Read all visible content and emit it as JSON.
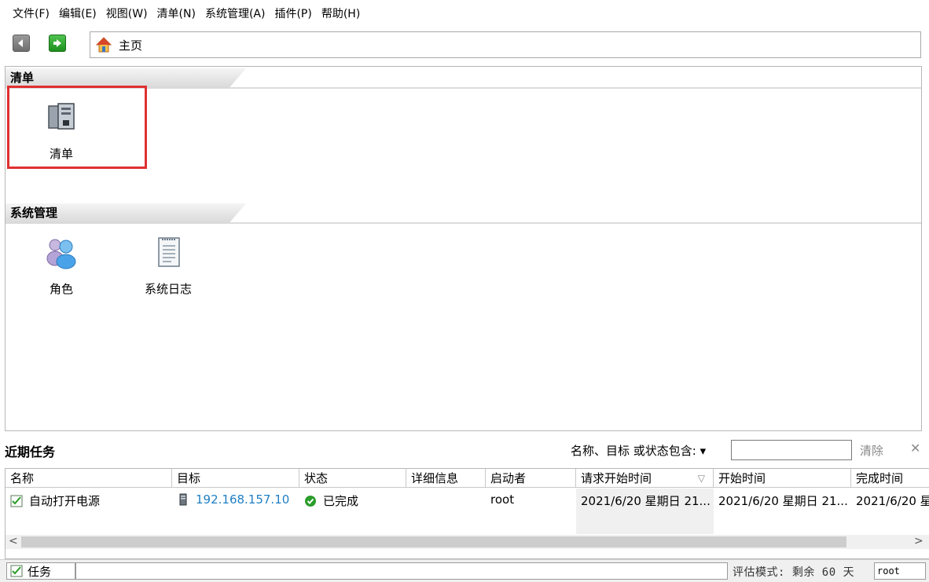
{
  "menu": [
    "文件(F)",
    "编辑(E)",
    "视图(W)",
    "清单(N)",
    "系统管理(A)",
    "插件(P)",
    "帮助(H)"
  ],
  "address": {
    "text": "主页"
  },
  "sections": [
    {
      "title": "清单",
      "tiles": [
        {
          "label": "清单",
          "icon": "inventory-icon"
        }
      ]
    },
    {
      "title": "系统管理",
      "tiles": [
        {
          "label": "角色",
          "icon": "roles-icon"
        },
        {
          "label": "系统日志",
          "icon": "system-log-icon"
        }
      ]
    }
  ],
  "recent_tasks": {
    "title": "近期任务",
    "filter_label": "名称、目标 或状态包含: ▾",
    "filter_value": "",
    "clear_label": "清除",
    "columns": [
      "名称",
      "目标",
      "状态",
      "详细信息",
      "启动者",
      "请求开始时间",
      "开始时间",
      "完成时间"
    ],
    "rows": [
      {
        "name": "自动打开电源",
        "target": "192.168.157.10",
        "status": "已完成",
        "details": "",
        "initiator": "root",
        "requested": "2021/6/20 星期日 21...",
        "start": "2021/6/20 星期日 21...",
        "completed": "2021/6/20 星"
      }
    ]
  },
  "statusbar": {
    "tasks_label": "任务",
    "eval_text": "评估模式: 剩余 60 天",
    "user": "root"
  },
  "colors": {
    "highlight": "#e03030",
    "link": "#1e7fc4",
    "success": "#2a9d2a"
  }
}
